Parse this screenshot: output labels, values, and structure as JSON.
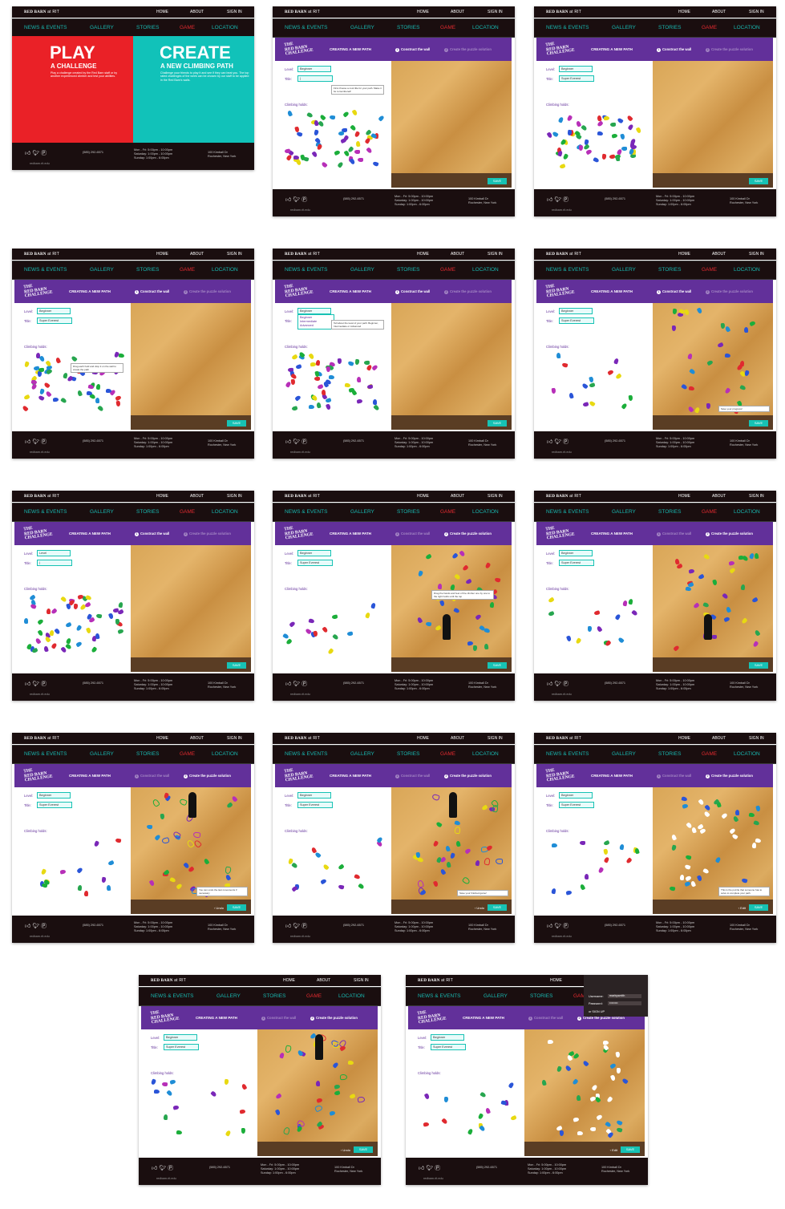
{
  "brand": {
    "name": "RED BARN",
    "suffix": "at RIT"
  },
  "topnav": [
    "HOME",
    "ABOUT",
    "SIGN IN"
  ],
  "mainnav": [
    "NEWS & EVENTS",
    "GALLERY",
    "STORIES",
    "GAME",
    "LOCATION"
  ],
  "home": {
    "play_title": "PLAY",
    "play_sub": "A CHALLENGE",
    "play_desc": "Play a challenge created by the Red Barn staff or by another experienced climber and test your abilities.",
    "create_title": "CREATE",
    "create_sub": "A NEW CLIMBING PATH",
    "create_desc": "Challenge your friends to play it and see if they can beat you. The top rated challenges of the week can be chosen by our staff to be applied in the Red Barn's walls."
  },
  "editor": {
    "logo_line1": "THE",
    "logo_line2": "RED BARN",
    "logo_line3": "CHALLENGE",
    "title": "CREATING A NEW PATH",
    "step1": "Construct the wall",
    "step2": "Create the puzzle solution",
    "level_label": "Level:",
    "title_label": "Title:",
    "holds_label": "Climbing holds:",
    "level_value": "Beginner",
    "level_placeholder": "Level",
    "title_value": "Super Everest",
    "save": "SAVE",
    "undo": "Undo",
    "edit": "Edit",
    "levels": [
      "Beginner",
      "Intermediate",
      "Advanced"
    ],
    "tips": {
      "title_tip": "First choose a cool title for your path. Make it be remembered!",
      "level_tip": "Tell about the level of your path: Beginner, Intermediate or Advanced",
      "holds_tip": "Drag each hold and drop it on the wall to create the path",
      "saved": "Save your progress!",
      "drag_climber": "Drag the hands and feet of the climber one by one to the right holds until the top",
      "undo_tip": "You can undo the last movements if necessary",
      "finished": "Save your finished game!",
      "solution": "This is the puzzle that someone has to solve to complete your path."
    },
    "signin": {
      "username_label": "Username:",
      "username": "markysmith",
      "password_label": "Password:",
      "password": "••••••••",
      "signup": "or SIGN UP"
    }
  },
  "footer": {
    "phone": "(585) 292-6571",
    "hours_days": [
      "Mon - Fri:",
      "Saturday:",
      "Sunday:"
    ],
    "hours_times": [
      "5:00pm - 10:00pm",
      "1:00pm - 10:00pm",
      "1:00pm - 6:00pm"
    ],
    "address": [
      "100 Kimball Dr",
      "Rochester, New York"
    ],
    "site": "redbarn.rit.edu"
  },
  "colors": {
    "purple": "#62309a",
    "teal": "#17c2b4",
    "red": "#ea2127",
    "dark": "#1a0e0f"
  }
}
